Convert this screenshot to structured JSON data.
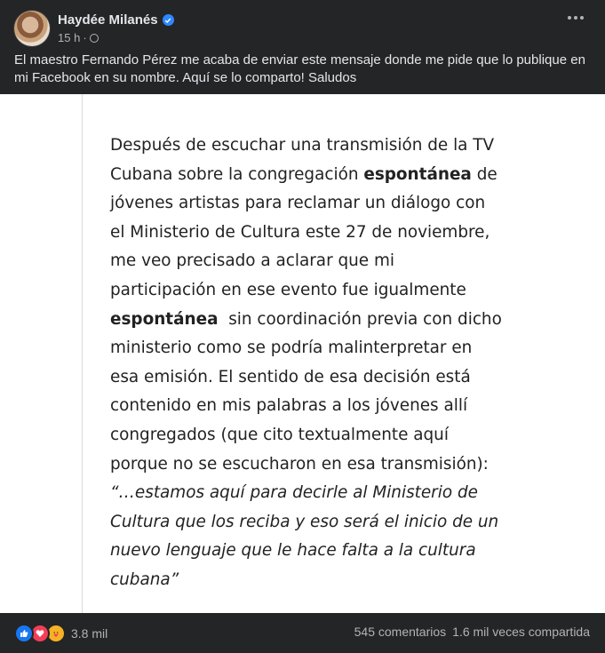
{
  "post": {
    "author": "Haydée Milanés",
    "time": "15 h",
    "time_separator": "·",
    "text_line1": "El maestro Fernando Pérez me acaba de enviar este mensaje donde me pide que lo publique en",
    "text_line2": "mi Facebook en su nombre. Aquí se lo comparto! Saludos"
  },
  "image_text": {
    "l1": " Después de escuchar una transmisión de la TV",
    "l2a": "Cubana sobre la congregación ",
    "l2b": "espontánea",
    "l2c": " de",
    "l3": "jóvenes artistas para reclamar un diálogo con",
    "l4": "el Ministerio de Cultura este 27 de noviembre,",
    "l5": "me veo precisado a aclarar que mi",
    "l6": "participación en ese evento fue igualmente",
    "l7a": "espontánea",
    "l7b": "  sin coordinación previa con dicho",
    "l8": "ministerio como se podría malinterpretar en",
    "l9": "esa emisión. El sentido de esa decisión está",
    "l10": "contenido en mis palabras a los jóvenes allí",
    "l11": "congregados (que cito textualmente aquí",
    "l12": "porque no se escucharon en esa transmisión):",
    "l13": "“…estamos aquí para decirle al Ministerio de",
    "l14": "Cultura que los reciba y eso será el inicio de un",
    "l15": "nuevo lenguaje que le hace falta a la cultura",
    "l16": "cubana”"
  },
  "footer": {
    "reaction_count": "3.8 mil",
    "comments": "545 comentarios",
    "shares": "1.6 mil veces compartida"
  },
  "icons": {
    "like": "like-icon",
    "love": "love-icon",
    "care": "care-icon",
    "verified": "verified-badge-icon",
    "audience": "globe-icon",
    "more": "more-options-icon"
  },
  "colors": {
    "background": "#242526",
    "text": "#e4e6eb",
    "secondary_text": "#b0b3b8",
    "verified": "#2d88ff",
    "like": "#1877f2",
    "love": "#f33e58",
    "care": "#f7b125"
  }
}
